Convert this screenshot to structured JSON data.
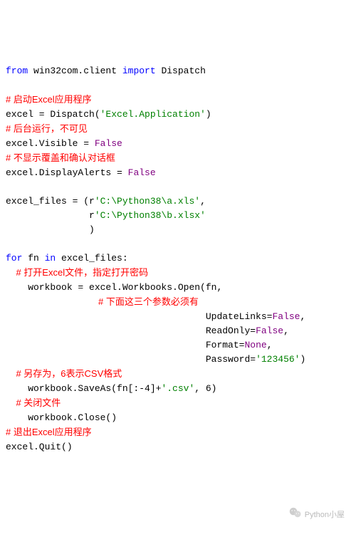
{
  "code": {
    "l1a": "from",
    "l1b": " win32com.client ",
    "l1c": "import",
    "l1d": " Dispatch",
    "l2": "# 启动Excel应用程序",
    "l3a": "excel = Dispatch(",
    "l3b": "'Excel.Application'",
    "l3c": ")",
    "l4": "# 后台运行，不可见",
    "l5a": "excel.Visible = ",
    "l5b": "False",
    "l6": "# 不显示覆盖和确认对话框",
    "l7a": "excel.DisplayAlerts = ",
    "l7b": "False",
    "l8a": "excel_files = (r",
    "l8b": "'C:\\Python38\\a.xls'",
    "l8c": ",",
    "l9a": "               r",
    "l9b": "'C:\\Python38\\b.xlsx'",
    "l10": "               )",
    "l11a": "for",
    "l11b": " fn ",
    "l11c": "in",
    "l11d": " excel_files:",
    "l12": "    # 打开Excel文件，指定打开密码",
    "l13": "    workbook = excel.Workbooks.Open(fn,",
    "l14": "                                    # 下面这三个参数必须有",
    "l15a": "                                    UpdateLinks=",
    "l15b": "False",
    "l15c": ",",
    "l16a": "                                    ReadOnly=",
    "l16b": "False",
    "l16c": ",",
    "l17a": "                                    Format=",
    "l17b": "None",
    "l17c": ",",
    "l18a": "                                    Password=",
    "l18b": "'123456'",
    "l18c": ")",
    "l19": "    # 另存为，6表示CSV格式",
    "l20a": "    workbook.SaveAs(fn[:-4]+",
    "l20b": "'.csv'",
    "l20c": ", 6)",
    "l21": "    # 关闭文件",
    "l22": "    workbook.Close()",
    "l23": "# 退出Excel应用程序",
    "l24": "excel.Quit()"
  },
  "watermark": {
    "text": "Python小屋"
  }
}
